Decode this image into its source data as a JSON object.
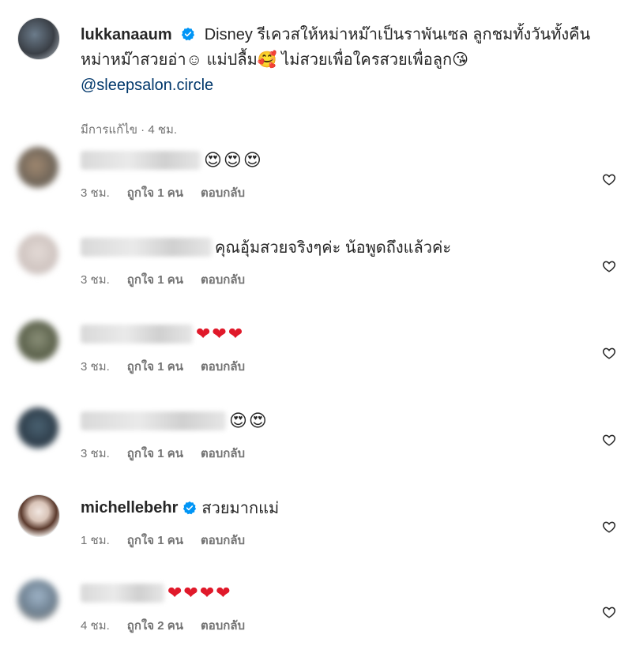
{
  "post": {
    "username": "lukkanaaum",
    "caption_text": "Disney รีเควสให้หม่าหม๊าเป็นราพันเซล ลูกชมทั้งวันทั้งคืนหม่าหม๊าสวยอ่า☺ แม่ปลื้ม🥰 ไม่สวยเพื่อใครสวยเพื่อลูก😘",
    "mention": "@sleepsalon.circle",
    "meta": "มีการแก้ไข · 4 ชม."
  },
  "comments": [
    {
      "user": "",
      "text": "😍😍😍",
      "time": "3 ชม.",
      "likes": "ถูกใจ 1 คน",
      "reply": "ตอบกลับ"
    },
    {
      "user": "",
      "text": "คุณอุ้มสวยจริงๆค่ะ น้อพูดถึงแล้วค่ะ",
      "time": "3 ชม.",
      "likes": "ถูกใจ 1 คน",
      "reply": "ตอบกลับ"
    },
    {
      "user": "",
      "text": "❤❤❤",
      "time": "3 ชม.",
      "likes": "ถูกใจ 1 คน",
      "reply": "ตอบกลับ"
    },
    {
      "user": "",
      "text": "😍😍",
      "time": "3 ชม.",
      "likes": "ถูกใจ 1 คน",
      "reply": "ตอบกลับ"
    },
    {
      "user": "michellebehr",
      "text": "สวยมากแม่",
      "time": "1 ชม.",
      "likes": "ถูกใจ 1 คน",
      "reply": "ตอบกลับ"
    },
    {
      "user": "",
      "text": "❤❤❤❤",
      "time": "4 ชม.",
      "likes": "ถูกใจ 2 คน",
      "reply": "ตอบกลับ"
    }
  ],
  "colors": {
    "verified": "#0095f6",
    "link": "#00376b",
    "meta": "#737373",
    "heart": "#e0192a"
  },
  "icons": {
    "verified": "verified-badge-icon",
    "like": "heart-outline-icon"
  }
}
